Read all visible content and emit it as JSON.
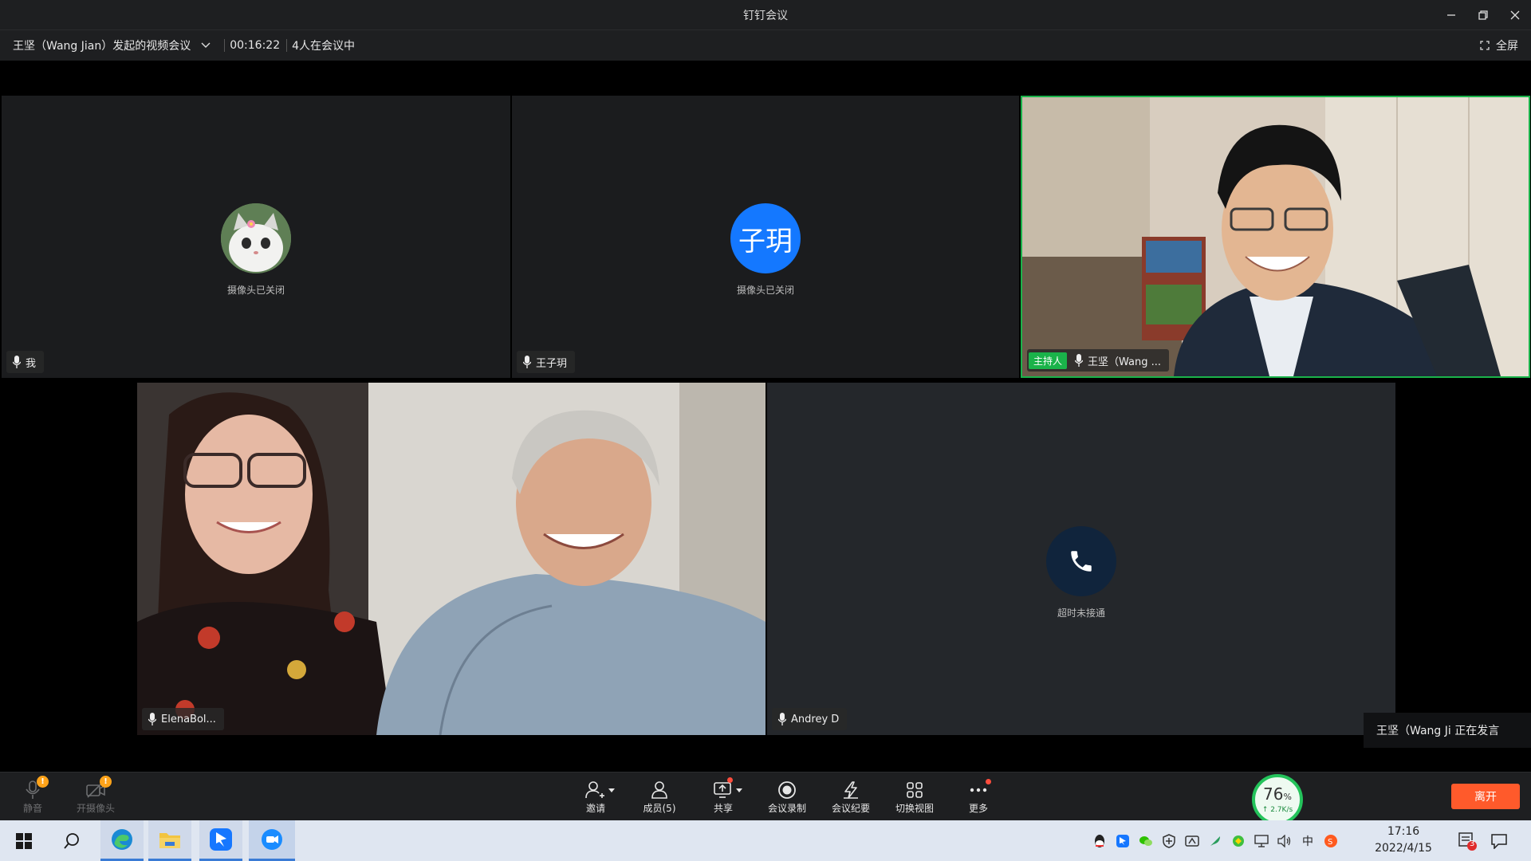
{
  "window": {
    "title": "钉钉会议",
    "controls": [
      "minimize",
      "restore",
      "close"
    ]
  },
  "meeting": {
    "title": "王坚（Wang Jian）发起的视频会议",
    "duration": "00:16:22",
    "participants_status": "4人在会议中",
    "fullscreen_label": "全屏"
  },
  "tiles": {
    "me": {
      "name": "我",
      "caption": "摄像头已关闭",
      "avatar_icon": "kitten-avatar"
    },
    "ziyue": {
      "name": "王子玥",
      "caption": "摄像头已关闭",
      "avatar_text": "子玥",
      "avatar_color": "#1478ff"
    },
    "host": {
      "badge": "主持人",
      "name": "王坚（Wang ...",
      "border_color": "#1ab34a"
    },
    "elena": {
      "name": "ElenaBol..."
    },
    "andrey": {
      "name": "Andrey D",
      "caption": "超时未接通",
      "call_icon": "phone-icon"
    }
  },
  "speaking": {
    "text": "王坚（Wang Ji  正在发言"
  },
  "toolbar": {
    "mute": {
      "label": "静音",
      "badge": "!"
    },
    "camera": {
      "label": "开摄像头",
      "badge": "!"
    },
    "invite": {
      "label": "邀请"
    },
    "members": {
      "label": "成员(5)"
    },
    "share": {
      "label": "共享"
    },
    "record": {
      "label": "会议录制"
    },
    "minutes": {
      "label": "会议纪要"
    },
    "view": {
      "label": "切换视图"
    },
    "more": {
      "label": "更多"
    },
    "network": {
      "percent": "76",
      "percent_unit": "%",
      "rate": "↑ 2.7K/s",
      "color": "#24c35b"
    },
    "leave": {
      "label": "离开",
      "color": "#ff5a2b"
    }
  },
  "taskbar": {
    "apps": [
      "windows-start",
      "search",
      "edge",
      "file-explorer",
      "dingtalk",
      "dingtalk-meeting"
    ],
    "clock_time": "17:16",
    "clock_date": "2022/4/15",
    "notification_count": "3",
    "ime_label": "中"
  }
}
